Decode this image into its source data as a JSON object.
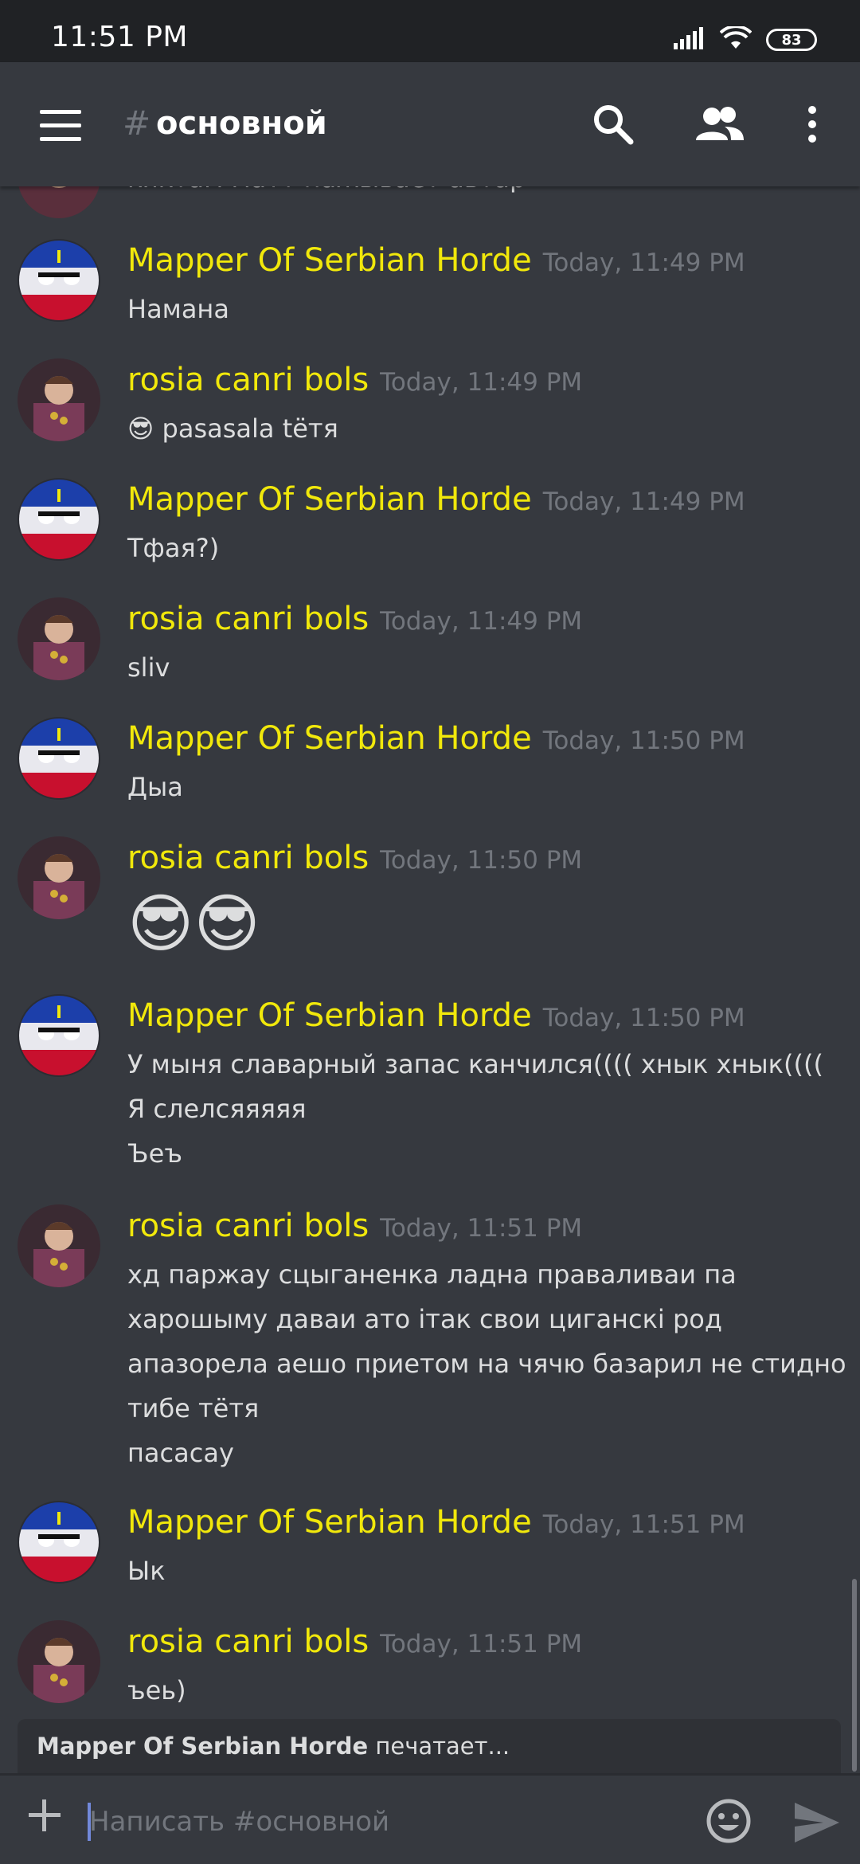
{
  "status_bar": {
    "time": "11:51 PM",
    "battery": "83",
    "icons": [
      "signal-icon",
      "wifi-icon",
      "battery-icon"
    ]
  },
  "header": {
    "hash": "#",
    "channel": "основной",
    "icons": [
      "menu-icon",
      "search-icon",
      "members-icon",
      "more-vertical-icon"
    ]
  },
  "colors": {
    "background": "#36393f",
    "username": "#f1e80b",
    "timestamp": "#72767d",
    "text": "#dcddde",
    "status_bar": "#202225"
  },
  "partial_message": "кяктам матт пажывает автар",
  "messages": [
    {
      "user": "Mapper Of Serbian Horde",
      "time": "Today, 11:49 PM",
      "lines": [
        "Намана"
      ]
    },
    {
      "user": "rosia canri bols",
      "time": "Today, 11:49 PM",
      "lines": [
        "pasasala tëтя"
      ],
      "emoji_prefix": "😎"
    },
    {
      "user": "Mapper Of Serbian Horde",
      "time": "Today, 11:49 PM",
      "lines": [
        "Тфая?)"
      ]
    },
    {
      "user": "rosia canri bols",
      "time": "Today, 11:49 PM",
      "lines": [
        "sliv"
      ]
    },
    {
      "user": "Mapper Of Serbian Horde",
      "time": "Today, 11:50 PM",
      "lines": [
        "Дыа"
      ]
    },
    {
      "user": "rosia canri bols",
      "time": "Today, 11:50 PM",
      "lines": [],
      "big_emoji": "😎😎"
    },
    {
      "user": "Mapper Of Serbian Horde",
      "time": "Today, 11:50 PM",
      "lines": [
        "У мыня славарный запас канчился(((( хнык хнык((((",
        "Я слелсяяяяя",
        "Ъеъ"
      ]
    },
    {
      "user": "rosia canri bols",
      "time": "Today, 11:51 PM",
      "lines": [
        "хд паржау сцыганенка ладна праваливаи па",
        "харошыму даваи ато ітак свои циганскі род",
        "апазорела аешо приетом на чячю базарил не стидно",
        "тибе тётя",
        "пасасау"
      ]
    },
    {
      "user": "Mapper Of Serbian Horde",
      "time": "Today, 11:51 PM",
      "lines": [
        "Ык"
      ]
    },
    {
      "user": "rosia canri bols",
      "time": "Today, 11:51 PM",
      "lines": [
        "ъеь)"
      ]
    }
  ],
  "typing": {
    "user": "Mapper Of Serbian Horde",
    "text": " печатает..."
  },
  "composer": {
    "placeholder": "Написать #основной",
    "value": ""
  }
}
